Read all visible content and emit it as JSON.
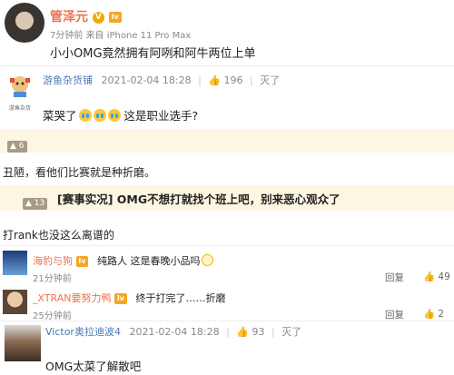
{
  "post": {
    "author": "管泽元",
    "verified_badge": "V",
    "level_badge": "lv",
    "meta": "7分钟前 来自 iPhone 11 Pro Max",
    "text": "小小OMG竟然拥有阿咧和阿牛两位上单"
  },
  "comment1": {
    "author": "游鱼杂货铺",
    "date": "2021-02-04 18:28",
    "likes": "196",
    "reply_label": "灭了",
    "avatar_caption": "游鱼杂货",
    "text": "菜哭了",
    "text_tail": " 这是职业选手?"
  },
  "quote1": {
    "up_count": "6",
    "text": "丑陋，看他们比赛就是种折磨。"
  },
  "quote2": {
    "up_count": "13",
    "title": "[赛事实况] OMG不想打就找个班上吧，别来恶心观众了",
    "text": "打rank也没这么离谱的"
  },
  "reply1": {
    "author": "海豹与狗",
    "level": "lv",
    "text": "纯路人 这是春晚小品吗",
    "time": "21分钟前",
    "reply_label": "回复",
    "likes": "49"
  },
  "reply2": {
    "author": "_XTRAN要努力鸭",
    "level": "lv",
    "text": "终于打完了……折磨",
    "time": "25分钟前",
    "reply_label": "回复",
    "likes": "2"
  },
  "comment2": {
    "author": "Victor奥拉迪波4",
    "date": "2021-02-04 18:28",
    "likes": "93",
    "reply_label": "灭了",
    "text": "OMG太菜了解散吧"
  }
}
